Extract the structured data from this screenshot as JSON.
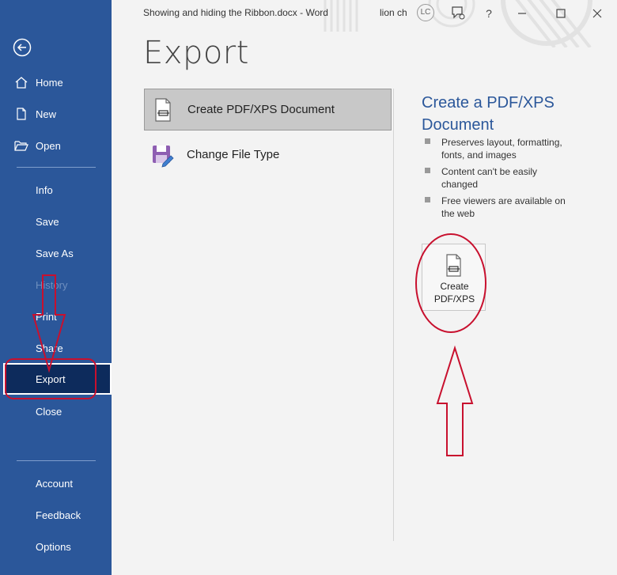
{
  "window": {
    "doc_title": "Showing and hiding the Ribbon.docx  -  Word",
    "user_name": "lion ch",
    "user_initials": "LC"
  },
  "sidebar": {
    "back_icon": "back-arrow-icon",
    "top_items": [
      {
        "label": "Home",
        "icon": "home-icon"
      },
      {
        "label": "New",
        "icon": "new-document-icon"
      },
      {
        "label": "Open",
        "icon": "open-folder-icon"
      }
    ],
    "mid_items": [
      {
        "label": "Info"
      },
      {
        "label": "Save"
      },
      {
        "label": "Save As"
      },
      {
        "label": "History",
        "disabled": true
      },
      {
        "label": "Print"
      },
      {
        "label": "Share"
      },
      {
        "label": "Export",
        "selected": true
      },
      {
        "label": "Close"
      }
    ],
    "bottom_items": [
      {
        "label": "Account"
      },
      {
        "label": "Feedback"
      },
      {
        "label": "Options"
      }
    ]
  },
  "main": {
    "title": "Export",
    "options": [
      {
        "label": "Create PDF/XPS Document",
        "icon": "pdf-document-icon",
        "selected": true
      },
      {
        "label": "Change File Type",
        "icon": "change-file-type-icon"
      }
    ],
    "panel": {
      "title": "Create a PDF/XPS Document",
      "bullets": [
        "Preserves layout, formatting, fonts, and images",
        "Content can't be easily changed",
        "Free viewers are available on the web"
      ],
      "button_label": "Create\nPDF/XPS",
      "button_icon": "pdf-document-icon"
    }
  },
  "colors": {
    "sidebar": "#2b579a",
    "selected": "#0d2b5c",
    "accent": "#2b579a",
    "annotation": "#c8102e"
  }
}
